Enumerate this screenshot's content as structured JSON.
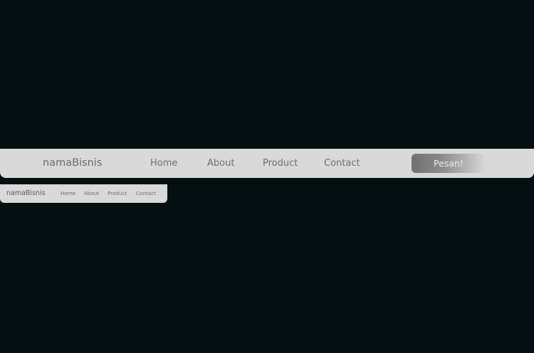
{
  "colors": {
    "page_background": "#040f11",
    "navbar_background": "#d9d9d9",
    "text_gray": "#707070",
    "cta_text": "#ececec"
  },
  "navbar_large": {
    "brand": "namaBisnis",
    "links": [
      "Home",
      "About",
      "Product",
      "Contact"
    ],
    "cta_label": "Pesan!"
  },
  "navbar_small": {
    "brand": "namaBisnis",
    "links": [
      "Home",
      "About",
      "Product",
      "Contact"
    ]
  }
}
